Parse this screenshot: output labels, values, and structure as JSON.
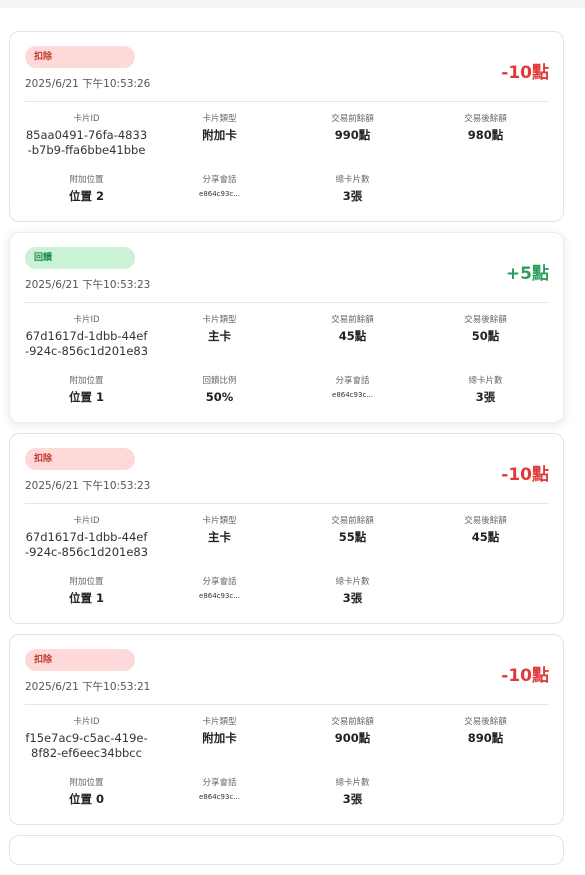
{
  "cards": [
    {
      "badge": "扣除",
      "type": "deduct",
      "timestamp": "2025/6/21 下午10:53:26",
      "amount": "-10點",
      "card_id_label": "卡片ID",
      "card_id": "85aa0491-76fa-4833-b7b9-ffa6bbe41bbe",
      "card_type_label": "卡片類型",
      "card_type": "附加卡",
      "before_label": "交易前餘額",
      "before": "990點",
      "after_label": "交易後餘額",
      "after": "980點",
      "position_label": "附加位置",
      "position": "位置 2",
      "share_label": "分享會話",
      "share": "e864c93c...",
      "total_label": "總卡片數",
      "total": "3張"
    },
    {
      "badge": "回饋",
      "type": "rebate",
      "timestamp": "2025/6/21 下午10:53:23",
      "amount": "+5點",
      "card_id_label": "卡片ID",
      "card_id": "67d1617d-1dbb-44ef-924c-856c1d201e83",
      "card_type_label": "卡片類型",
      "card_type": "主卡",
      "before_label": "交易前餘額",
      "before": "45點",
      "after_label": "交易後餘額",
      "after": "50點",
      "position_label": "附加位置",
      "position": "位置 1",
      "ratio_label": "回饋比例",
      "ratio": "50%",
      "share_label": "分享會話",
      "share": "e864c93c...",
      "total_label": "總卡片數",
      "total": "3張"
    },
    {
      "badge": "扣除",
      "type": "deduct",
      "timestamp": "2025/6/21 下午10:53:23",
      "amount": "-10點",
      "card_id_label": "卡片ID",
      "card_id": "67d1617d-1dbb-44ef-924c-856c1d201e83",
      "card_type_label": "卡片類型",
      "card_type": "主卡",
      "before_label": "交易前餘額",
      "before": "55點",
      "after_label": "交易後餘額",
      "after": "45點",
      "position_label": "附加位置",
      "position": "位置 1",
      "share_label": "分享會話",
      "share": "e864c93c...",
      "total_label": "總卡片數",
      "total": "3張"
    },
    {
      "badge": "扣除",
      "type": "deduct",
      "timestamp": "2025/6/21 下午10:53:21",
      "amount": "-10點",
      "card_id_label": "卡片ID",
      "card_id": "f15e7ac9-c5ac-419e-8f82-ef6eec34bbcc",
      "card_type_label": "卡片類型",
      "card_type": "附加卡",
      "before_label": "交易前餘額",
      "before": "900點",
      "after_label": "交易後餘額",
      "after": "890點",
      "position_label": "附加位置",
      "position": "位置 0",
      "share_label": "分享會話",
      "share": "e864c93c...",
      "total_label": "總卡片數",
      "total": "3張"
    }
  ],
  "colors": {
    "deduct_badge_bg": "#fdd9d9",
    "deduct_text": "#e03a3a",
    "rebate_badge_bg": "#c9f2d6",
    "rebate_text": "#2f9e5b"
  }
}
